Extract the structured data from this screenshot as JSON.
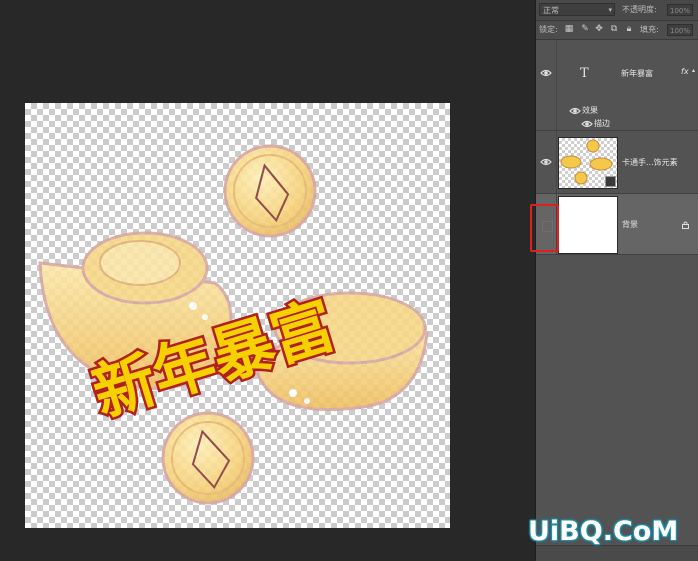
{
  "options_bar": {
    "blend_mode": "正常",
    "opacity_label": "不透明度:",
    "opacity_value": "100%",
    "lock_label": "锁定:",
    "fill_label": "填充:",
    "fill_value": "100%"
  },
  "layers": {
    "text_layer": {
      "name": "新年暴富",
      "type_glyph": "T",
      "fx_glyph": "fx",
      "effects_label": "效果",
      "stroke_label": "描边"
    },
    "image_layer": {
      "name": "卡通手...饰元素"
    },
    "background_layer": {
      "name": "背景"
    }
  },
  "canvas_art": {
    "title_text": "新年暴富",
    "title_fill_color": "#f7d000",
    "title_stroke_color": "#b0201e",
    "gold_color": "#f5cf7a"
  },
  "watermark": "UiBQ.CoM",
  "colors": {
    "highlight": "#e02020",
    "panel_bg": "#535353",
    "selected_layer_bg": "#656565"
  }
}
